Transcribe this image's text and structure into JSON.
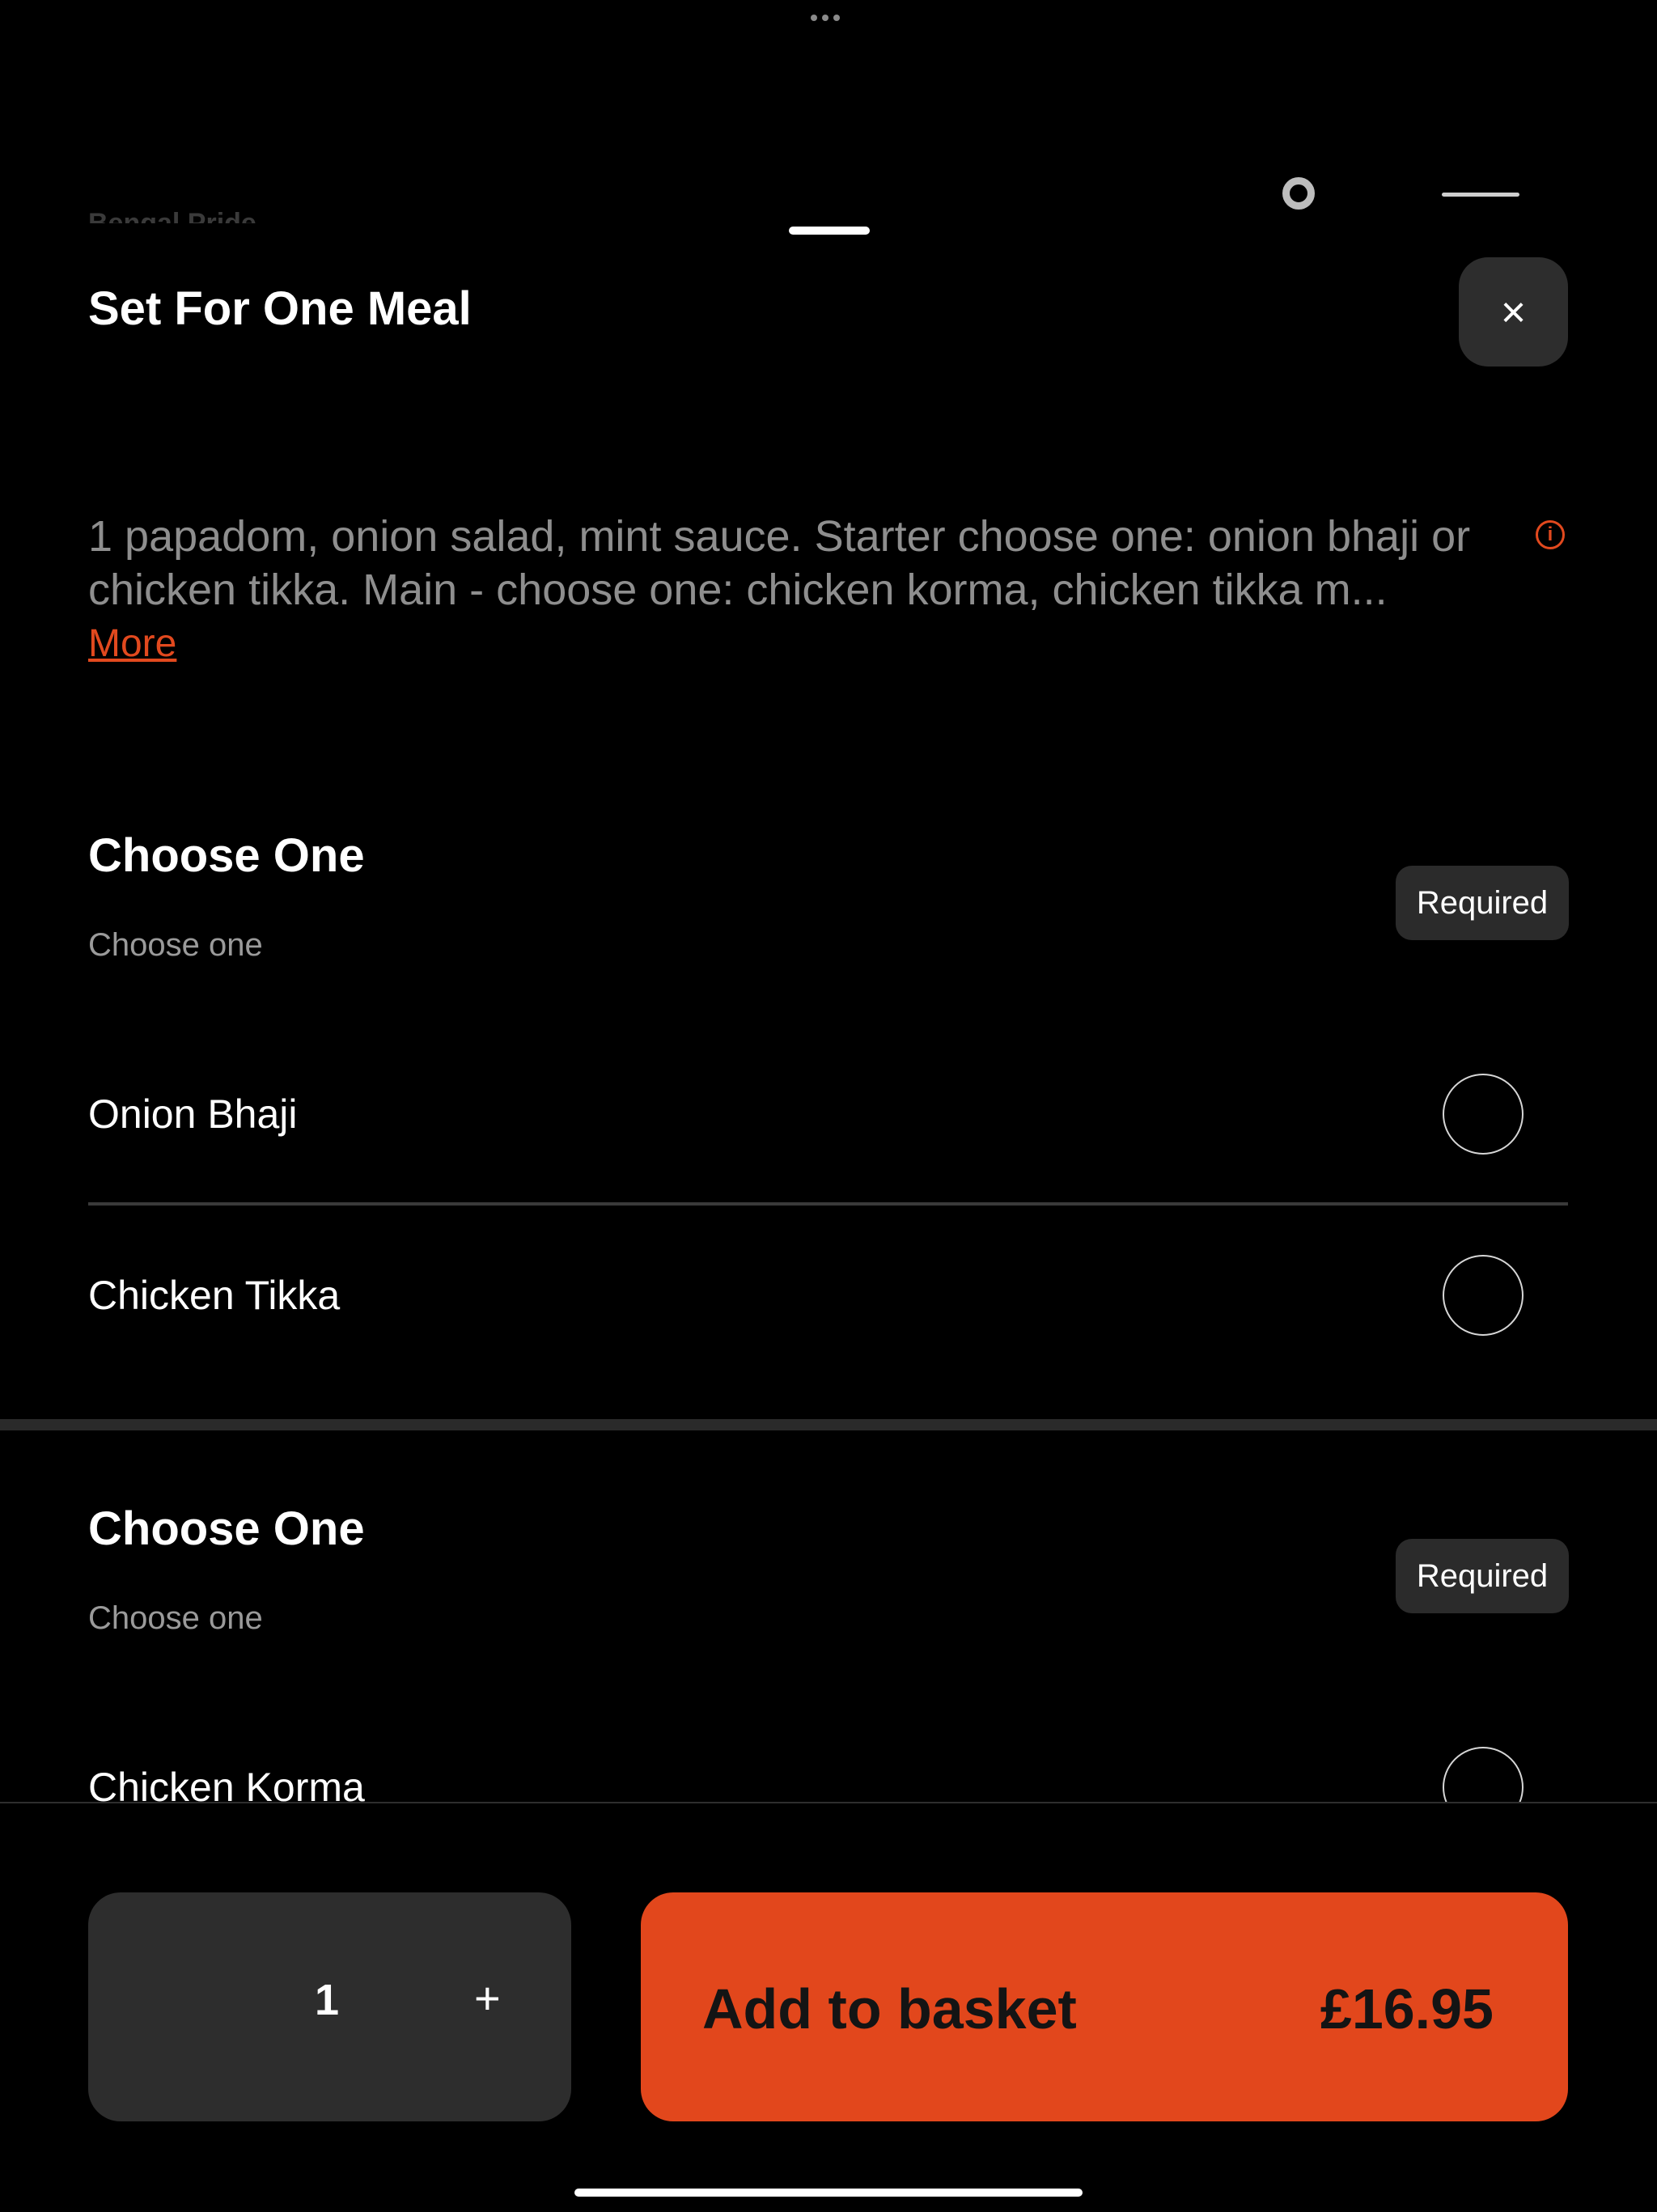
{
  "background": {
    "restaurant_name": "Bengal Pride"
  },
  "modal": {
    "title": "Set For One Meal",
    "close_icon": "×",
    "description": "1 papadom, onion salad, mint sauce. Starter choose one: onion bhaji or chicken tikka. Main - choose one: chicken korma, chicken tikka m...",
    "more_label": "More",
    "info_icon": "i"
  },
  "groups": [
    {
      "title": "Choose One",
      "subtitle": "Choose one",
      "badge": "Required",
      "options": [
        {
          "label": "Onion Bhaji"
        },
        {
          "label": "Chicken Tikka"
        }
      ]
    },
    {
      "title": "Choose One",
      "subtitle": "Choose one",
      "badge": "Required",
      "options": [
        {
          "label": "Chicken Korma"
        }
      ]
    }
  ],
  "footer": {
    "quantity": "1",
    "plus_label": "+",
    "add_label": "Add to basket",
    "price": "£16.95"
  },
  "colors": {
    "accent": "#e2471c",
    "background": "#000000",
    "surface": "#2d2d2d"
  }
}
